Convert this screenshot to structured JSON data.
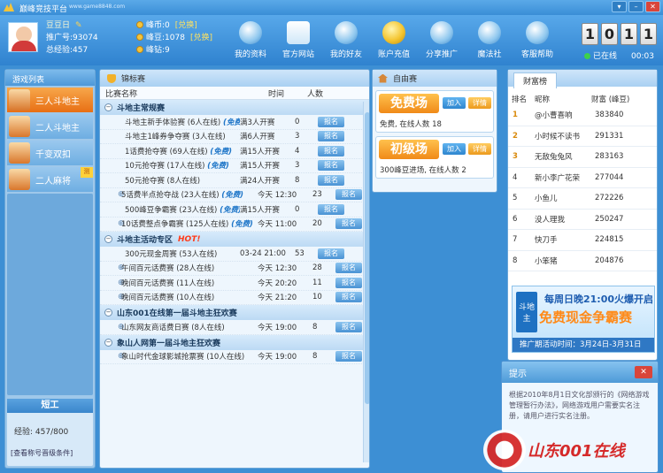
{
  "window": {
    "title": "巅峰竞技平台",
    "url": "www.game8848.com"
  },
  "user": {
    "name": "豆豆日",
    "account_label": "推广号:93074",
    "exp_label": "总经验:457",
    "coin_label": "峰币:0",
    "gold_label": "峰豆:1078",
    "gem_label": "峰钻:9",
    "link_coin": "[兑换]",
    "link_gold": "[兑换]"
  },
  "nav": [
    {
      "label": "我的资料",
      "icon": "user-icon"
    },
    {
      "label": "官方网站",
      "icon": "home-icon"
    },
    {
      "label": "我的好友",
      "icon": "friends-icon"
    },
    {
      "label": "账户充值",
      "icon": "gold-coin-icon"
    },
    {
      "label": "分享推广",
      "icon": "share-icon"
    },
    {
      "label": "魔法社",
      "icon": "magic-wand-icon"
    },
    {
      "label": "客服帮助",
      "icon": "support-icon"
    }
  ],
  "counter": {
    "digits": [
      "1",
      "0",
      "1",
      "1"
    ],
    "status": "已在线",
    "time": "00:03"
  },
  "games": {
    "header": "游戏列表",
    "items": [
      {
        "label": "三人斗地主",
        "selected": true
      },
      {
        "label": "二人斗地主",
        "selected": false
      },
      {
        "label": "千变双扣",
        "selected": false
      },
      {
        "label": "二人麻将",
        "selected": false,
        "tag": "测"
      }
    ],
    "rank_label": "短工",
    "exp_text": "经验: 457/800",
    "check_text": "[查看称号晋级条件]"
  },
  "matches": {
    "tab": "锦标赛",
    "col_name": "比赛名称",
    "col_time": "时间",
    "col_count": "人数",
    "auto_tag": "(免费)",
    "signup": "报名",
    "groups": [
      {
        "title": "斗地主常规赛",
        "hot": "",
        "rows": [
          {
            "name": "斗地主新手体验赛 (6人在线)",
            "auto": true,
            "time": "满3人开赛",
            "count": "0",
            "expand": false
          },
          {
            "name": "斗地主1峰券争夺赛 (3人在线)",
            "auto": false,
            "time": "满6人开赛",
            "count": "3",
            "expand": false
          },
          {
            "name": "1话费抢夺赛 (69人在线)",
            "auto": true,
            "time": "满15人开赛",
            "count": "4",
            "expand": false
          },
          {
            "name": "10元抢夺赛 (17人在线)",
            "auto": true,
            "time": "满15人开赛",
            "count": "3",
            "expand": false
          },
          {
            "name": "50元抢夺赛 (8人在线)",
            "auto": false,
            "time": "满24人开赛",
            "count": "8",
            "expand": false
          },
          {
            "name": "5话费半点抢夺战 (23人在线)",
            "auto": true,
            "time": "今天 12:30",
            "count": "23",
            "expand": true
          },
          {
            "name": "500峰豆争霸赛 (23人在线)",
            "auto": true,
            "time": "满15人开赛",
            "count": "0",
            "expand": false
          },
          {
            "name": "10话费整点争霸赛 (125人在线)",
            "auto": true,
            "time": "今天 11:00",
            "count": "20",
            "expand": true
          }
        ]
      },
      {
        "title": "斗地主活动专区",
        "hot": "HOT!",
        "rows": [
          {
            "name": "300元现金周赛 (53人在线)",
            "auto": false,
            "time": "03-24 21:00",
            "count": "53",
            "expand": false
          },
          {
            "name": "午间百元话费赛 (28人在线)",
            "auto": false,
            "time": "今天 12:30",
            "count": "28",
            "expand": true
          },
          {
            "name": "晚间百元话费赛 (11人在线)",
            "auto": false,
            "time": "今天 20:20",
            "count": "11",
            "expand": true
          },
          {
            "name": "晚间百元话费赛 (10人在线)",
            "auto": false,
            "time": "今天 21:20",
            "count": "10",
            "expand": true
          }
        ]
      },
      {
        "title": "山东001在线第一届斗地主狂欢赛",
        "hot": "",
        "rows": [
          {
            "name": "山东网友商话费日赛 (8人在线)",
            "auto": false,
            "time": "今天 19:00",
            "count": "8",
            "expand": true
          }
        ]
      },
      {
        "title": "象山人网第一届斗地主狂欢赛",
        "hot": "",
        "rows": [
          {
            "name": "象山时代金球影城抢票赛 (10人在线)",
            "auto": false,
            "time": "今天 19:00",
            "count": "8",
            "expand": true
          }
        ]
      }
    ]
  },
  "free": {
    "tab": "自由赛",
    "join": "加入",
    "detail": "详情",
    "rooms": [
      {
        "title": "免费场",
        "desc": "免费, 在线人数 18"
      },
      {
        "title": "初级场",
        "desc": "300峰豆进场, 在线人数 2"
      }
    ]
  },
  "wealth": {
    "tab": "财富榜",
    "col_rank": "排名",
    "col_name": "昵称",
    "col_value": "财富 (峰豆)",
    "rows": [
      {
        "rank": "1",
        "name": "@小曹喜响",
        "value": "383840"
      },
      {
        "rank": "2",
        "name": "小时候不读书",
        "value": "291331"
      },
      {
        "rank": "3",
        "name": "无敌兔兔风",
        "value": "283163"
      },
      {
        "rank": "4",
        "name": "新小李广花荣",
        "value": "277044"
      },
      {
        "rank": "5",
        "name": "小鱼儿",
        "value": "272226"
      },
      {
        "rank": "6",
        "name": "没人理我",
        "value": "250247"
      },
      {
        "rank": "7",
        "name": "快刀手",
        "value": "224815"
      },
      {
        "rank": "8",
        "name": "小笨猪",
        "value": "204876"
      }
    ],
    "banner_tag": "斗地主",
    "banner_line1": "每周日晚21:00火爆开启",
    "banner_line2": "免费现金争霸赛",
    "banner_line3": "推广期活动时间：3月24日-3月31日"
  },
  "popup": {
    "title": "提示",
    "close": "✕",
    "body": "根据2010年8月1日文化部颁行的《网络游戏管理暂行办法》，网络游戏用户需要实名注册，请用户进行实名注册。"
  },
  "watermark": {
    "text": "山东001在线"
  }
}
